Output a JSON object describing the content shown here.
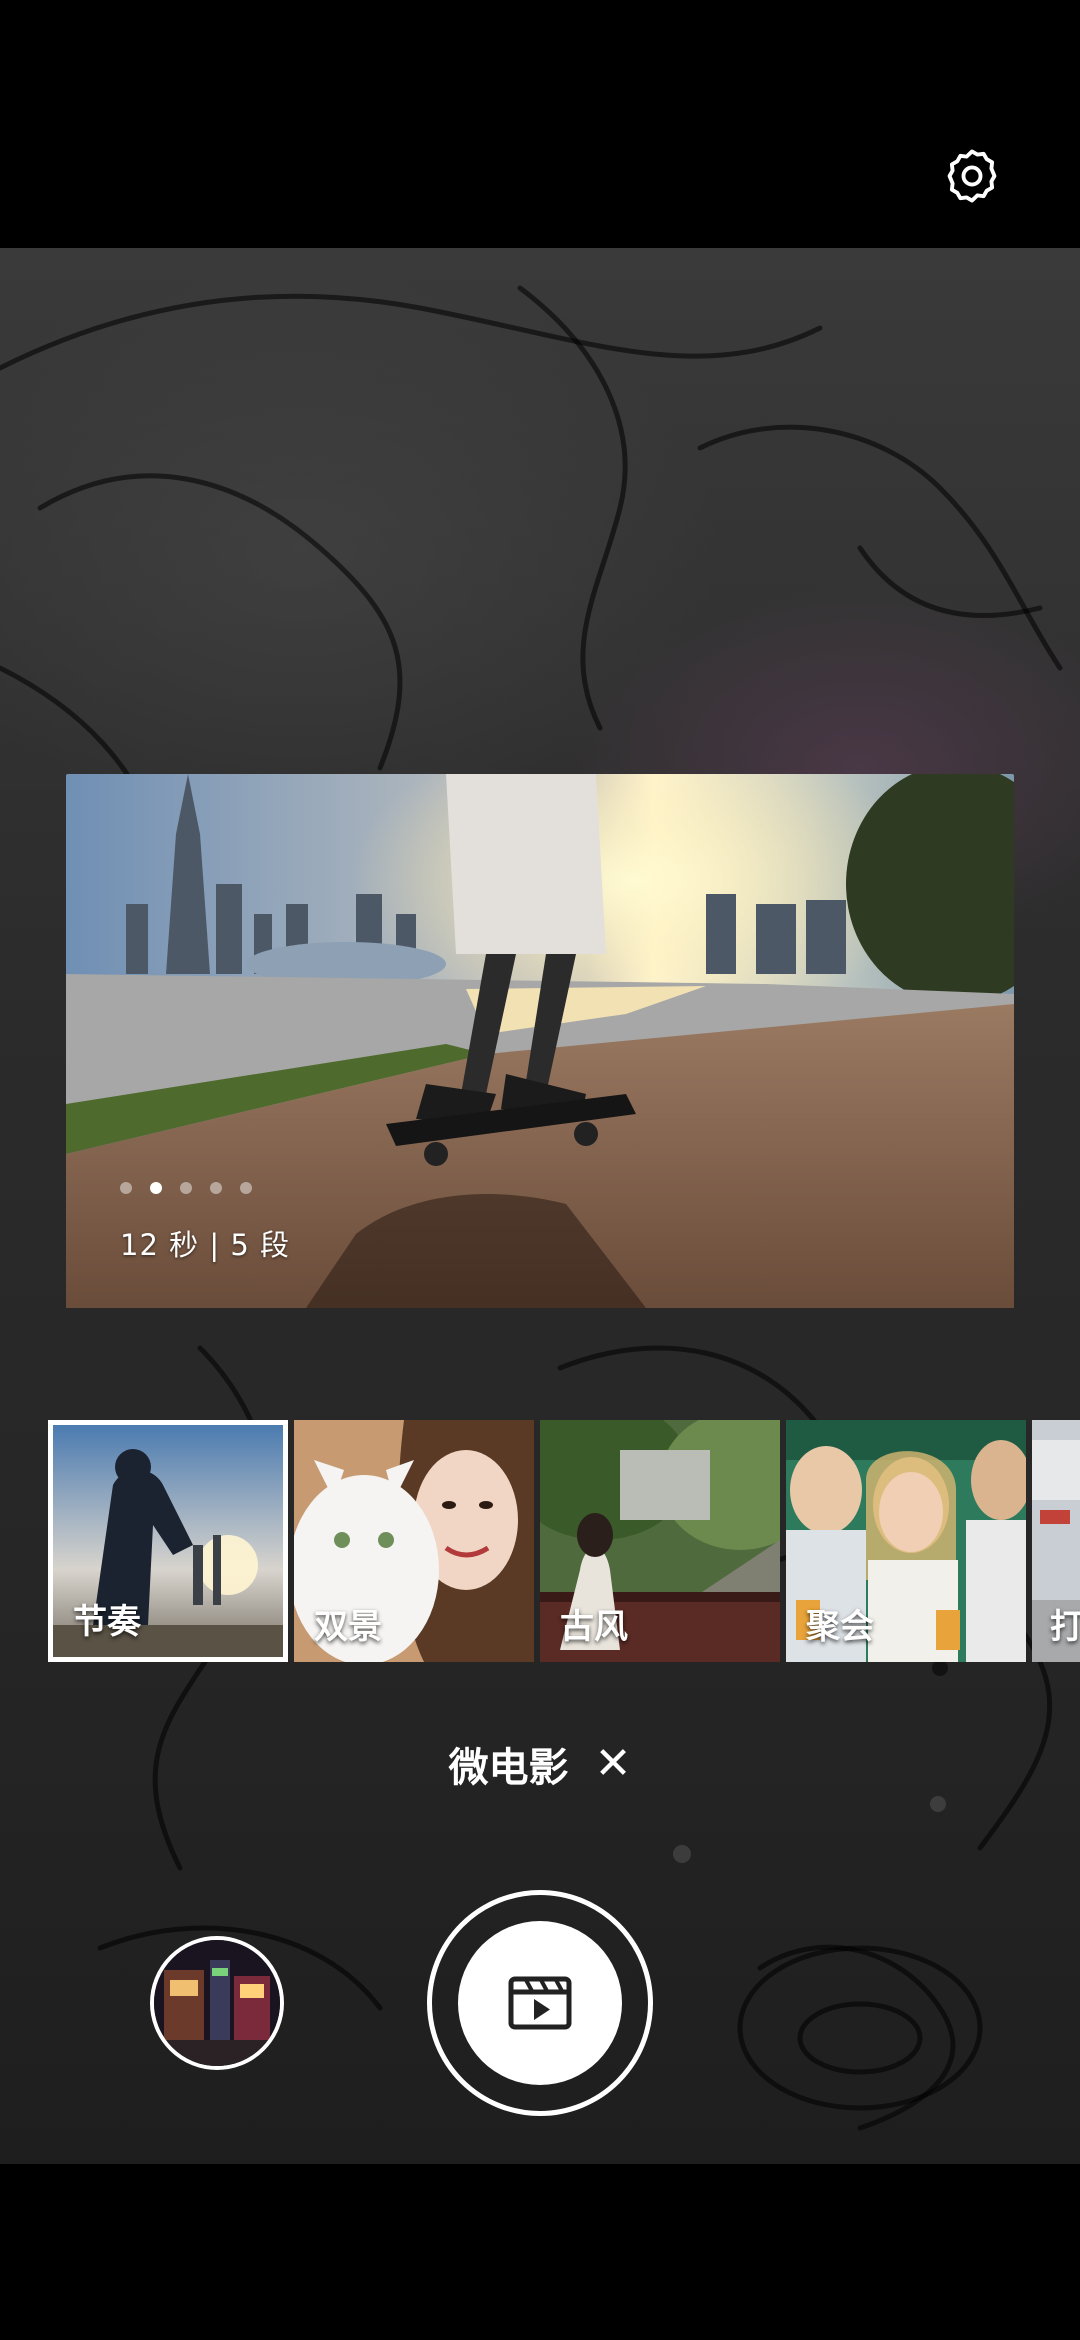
{
  "top_bar": {
    "settings_icon": "gear-icon"
  },
  "preview": {
    "page_dots": 5,
    "active_dot": 1,
    "duration_text": "12 秒 | 5 段"
  },
  "templates": [
    {
      "label": "节奏",
      "selected": true
    },
    {
      "label": "双景",
      "selected": false
    },
    {
      "label": "古风",
      "selected": false
    },
    {
      "label": "聚会",
      "selected": false
    },
    {
      "label": "打",
      "selected": false
    }
  ],
  "mode": {
    "label": "微电影",
    "close_symbol": "✕"
  },
  "controls": {
    "gallery_icon": "gallery-thumbnail",
    "shutter_icon": "video-clapper-icon"
  }
}
